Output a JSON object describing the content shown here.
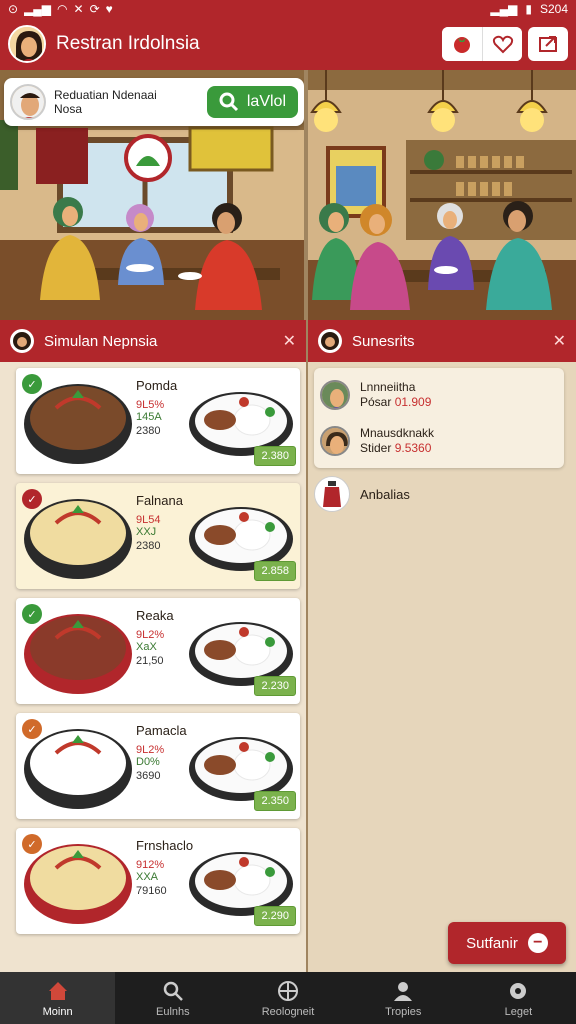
{
  "status": {
    "time": "S204"
  },
  "app": {
    "title": "Restran Irdolnsia"
  },
  "search_card": {
    "line1": "Reduatian Ndenaai",
    "line2": "Nosa",
    "button_label": "laVlol"
  },
  "left_panel": {
    "title": "Simulan Nepnsia"
  },
  "right_panel": {
    "title": "Sunesrits"
  },
  "foods": [
    {
      "name": "Pomda",
      "pct": "9L5%",
      "sub": "145A",
      "num": "2380",
      "price": "2.380",
      "badge_color": "#3a9a3b"
    },
    {
      "name": "Falnana",
      "pct": "9L54",
      "sub": "XXJ",
      "num": "2380",
      "price": "2.858",
      "badge_color": "#b1262b"
    },
    {
      "name": "Reaka",
      "pct": "9L2%",
      "sub": "XaX",
      "num": "21,50",
      "price": "2.230",
      "badge_color": "#3a9a3b"
    },
    {
      "name": "Pamacla",
      "pct": "9L2%",
      "sub": "D0%",
      "num": "3690",
      "price": "2.350",
      "badge_color": "#d06a2a"
    },
    {
      "name": "Frnshaclo",
      "pct": "912%",
      "sub": "XXA",
      "num": "79160",
      "price": "2.290",
      "badge_color": "#d06a2a"
    }
  ],
  "reviewers": [
    {
      "name": "Lnnneiitha",
      "label": "Pósar",
      "num": "01.909"
    },
    {
      "name": "Mnausdknakk",
      "label": "Stider",
      "num": "9.5360"
    }
  ],
  "solo_item": {
    "label": "Anbalias"
  },
  "fab": {
    "label": "Sutfanir"
  },
  "nav": [
    {
      "label": "Moinn",
      "icon": "home-icon"
    },
    {
      "label": "Eulnhs",
      "icon": "search-icon"
    },
    {
      "label": "Reologneit",
      "icon": "grid-icon"
    },
    {
      "label": "Tropies",
      "icon": "profile-icon"
    },
    {
      "label": "Leget",
      "icon": "settings-icon"
    }
  ],
  "colors": {
    "primary": "#b1262b",
    "accent_green": "#3a9a3b",
    "price_green": "#7bb24d"
  }
}
